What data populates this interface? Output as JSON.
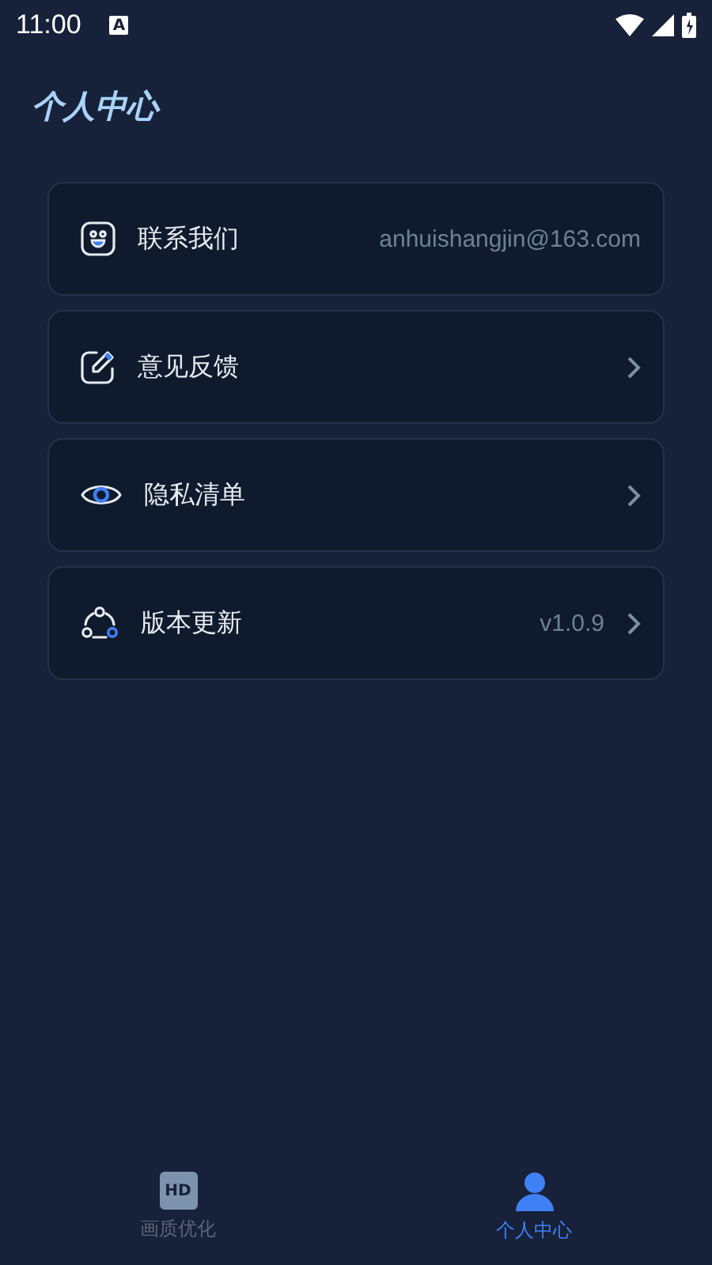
{
  "status_bar": {
    "time": "11:00",
    "notice": "A"
  },
  "title": "个人中心",
  "menu": [
    {
      "label": "联系我们",
      "kind": "value",
      "value": "anhuishangjin@163.com"
    },
    {
      "label": "意见反馈",
      "kind": "chevron"
    },
    {
      "label": "隐私清单",
      "kind": "chevron"
    },
    {
      "label": "版本更新",
      "kind": "value_chevron",
      "value": "v1.0.9"
    }
  ],
  "tabs": [
    {
      "label": "画质优化",
      "badge": "HD",
      "selected": false
    },
    {
      "label": "个人中心",
      "selected": true
    }
  ]
}
